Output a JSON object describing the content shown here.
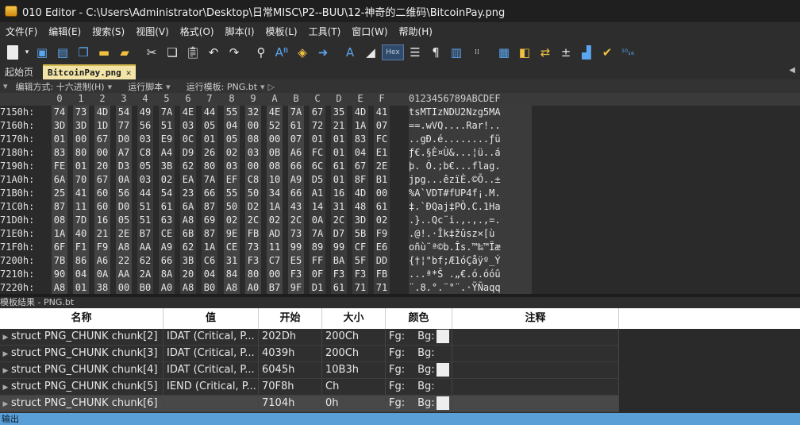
{
  "window": {
    "title": "010 Editor - C:\\Users\\Administrator\\Desktop\\日常MISC\\P2--BUU\\12-神奇的二维码\\BitcoinPay.png"
  },
  "menu": [
    "文件(F)",
    "编辑(E)",
    "搜索(S)",
    "视图(V)",
    "格式(O)",
    "脚本(I)",
    "模板(L)",
    "工具(T)",
    "窗口(W)",
    "帮助(H)"
  ],
  "toolbar": {
    "hex_label": "Hex",
    "icons": [
      "new-file-icon",
      "new-file-dropdown-icon",
      "save-icon",
      "save-as-icon",
      "save-all-icon",
      "open-folder-icon",
      "open-multiple-icon",
      "cut-icon",
      "copy-icon",
      "paste-icon",
      "undo-icon",
      "redo-icon",
      "find-icon",
      "find-replace-icon",
      "find-in-files-icon",
      "goto-icon",
      "font-icon",
      "highlight-icon",
      "hex-mode-icon",
      "word-wrap-icon",
      "show-whitespace-icon",
      "columns-icon",
      "binary-icon",
      "calculator-icon",
      "compare-icon",
      "swap-icon",
      "math-icon",
      "histogram-icon",
      "checksum-icon",
      "base-convert-icon"
    ]
  },
  "tabs": {
    "start_page": "起始页",
    "active_file": "BitcoinPay.png",
    "close": "✕"
  },
  "options": {
    "edit_as": "编辑方式: 十六进制(H)",
    "run_script": "运行脚本",
    "run_template": "运行模板: PNG.bt"
  },
  "hex": {
    "header_cols": [
      "0",
      "1",
      "2",
      "3",
      "4",
      "5",
      "6",
      "7",
      "8",
      "9",
      "A",
      "B",
      "C",
      "D",
      "E",
      "F"
    ],
    "header_ascii": "0123456789ABCDEF",
    "rows": [
      {
        "addr": "7150h:",
        "bytes": [
          "74",
          "73",
          "4D",
          "54",
          "49",
          "7A",
          "4E",
          "44",
          "55",
          "32",
          "4E",
          "7A",
          "67",
          "35",
          "4D",
          "41"
        ],
        "ascii": "tsMTIzNDU2Nzg5MA"
      },
      {
        "addr": "7160h:",
        "bytes": [
          "3D",
          "3D",
          "1D",
          "77",
          "56",
          "51",
          "03",
          "05",
          "04",
          "00",
          "52",
          "61",
          "72",
          "21",
          "1A",
          "07"
        ],
        "ascii": "==.wVQ....Rar!.."
      },
      {
        "addr": "7170h:",
        "bytes": [
          "01",
          "00",
          "67",
          "D0",
          "03",
          "E9",
          "0C",
          "01",
          "05",
          "08",
          "00",
          "07",
          "01",
          "01",
          "83",
          "FC"
        ],
        "ascii": "..gÐ.é........ƒü"
      },
      {
        "addr": "7180h:",
        "bytes": [
          "83",
          "80",
          "00",
          "A7",
          "C8",
          "A4",
          "D9",
          "26",
          "02",
          "03",
          "0B",
          "A6",
          "FC",
          "01",
          "04",
          "E1"
        ],
        "ascii": "ƒ€.§È¤Ù&...¦ü..á"
      },
      {
        "addr": "7190h:",
        "bytes": [
          "FE",
          "01",
          "20",
          "D3",
          "05",
          "3B",
          "62",
          "80",
          "03",
          "00",
          "08",
          "66",
          "6C",
          "61",
          "67",
          "2E"
        ],
        "ascii": "þ. Ó.;b€...flag."
      },
      {
        "addr": "71A0h:",
        "bytes": [
          "6A",
          "70",
          "67",
          "0A",
          "03",
          "02",
          "EA",
          "7A",
          "EF",
          "C8",
          "10",
          "A9",
          "D5",
          "01",
          "8F",
          "B1"
        ],
        "ascii": "jpg...êzïÈ.©Õ..±"
      },
      {
        "addr": "71B0h:",
        "bytes": [
          "25",
          "41",
          "60",
          "56",
          "44",
          "54",
          "23",
          "66",
          "55",
          "50",
          "34",
          "66",
          "A1",
          "16",
          "4D",
          "00"
        ],
        "ascii": "%A`VDT#fUP4f¡.M."
      },
      {
        "addr": "71C0h:",
        "bytes": [
          "87",
          "11",
          "60",
          "D0",
          "51",
          "61",
          "6A",
          "87",
          "50",
          "D2",
          "1A",
          "43",
          "14",
          "31",
          "48",
          "61"
        ],
        "ascii": "‡.`ÐQaj‡PÒ.C.1Ha"
      },
      {
        "addr": "71D0h:",
        "bytes": [
          "08",
          "7D",
          "16",
          "05",
          "51",
          "63",
          "A8",
          "69",
          "02",
          "2C",
          "02",
          "2C",
          "0A",
          "2C",
          "3D",
          "02"
        ],
        "ascii": ".}..Qc¨i.,.,.,=."
      },
      {
        "addr": "71E0h:",
        "bytes": [
          "1A",
          "40",
          "21",
          "2E",
          "B7",
          "CE",
          "6B",
          "87",
          "9E",
          "FB",
          "AD",
          "73",
          "7A",
          "D7",
          "5B",
          "F9"
        ],
        "ascii": ".@!.·Îk‡žû­sz×[ù"
      },
      {
        "addr": "71F0h:",
        "bytes": [
          "6F",
          "F1",
          "F9",
          "A8",
          "AA",
          "A9",
          "62",
          "1A",
          "CE",
          "73",
          "11",
          "99",
          "89",
          "99",
          "CF",
          "E6"
        ],
        "ascii": "oñù¨ª©b.Îs.™‰™Ïæ"
      },
      {
        "addr": "7200h:",
        "bytes": [
          "7B",
          "86",
          "A6",
          "22",
          "62",
          "66",
          "3B",
          "C6",
          "31",
          "F3",
          "C7",
          "E5",
          "FF",
          "BA",
          "5F",
          "DD"
        ],
        "ascii": "{†¦\"bf;Æ1óÇåÿº_Ý"
      },
      {
        "addr": "7210h:",
        "bytes": [
          "90",
          "04",
          "0A",
          "AA",
          "2A",
          "8A",
          "20",
          "04",
          "84",
          "80",
          "00",
          "F3",
          "0F",
          "F3",
          "F3",
          "FB"
        ],
        "ascii": "...ª*Š .„€.ó.óóû"
      },
      {
        "addr": "7220h:",
        "bytes": [
          "A8",
          "01",
          "38",
          "00",
          "B0",
          "A0",
          "A8",
          "B0",
          "A8",
          "A0",
          "B7",
          "9F",
          "D1",
          "61",
          "71",
          "71"
        ],
        "ascii": "¨.8.°.¨°¨.·ŸÑaqq"
      }
    ]
  },
  "template_results": {
    "title": "模板结果 - PNG.bt",
    "columns": [
      "名称",
      "值",
      "开始",
      "大小",
      "颜色",
      "注释"
    ],
    "rows": [
      {
        "name": "struct PNG_CHUNK chunk[2]",
        "value": "IDAT  (Critical, P...",
        "start": "202Dh",
        "size": "200Ch",
        "fg": "Fg:",
        "bg": "Bg:",
        "bg_swatch": true
      },
      {
        "name": "struct PNG_CHUNK chunk[3]",
        "value": "IDAT  (Critical, P...",
        "start": "4039h",
        "size": "200Ch",
        "fg": "Fg:",
        "bg": "Bg:",
        "bg_swatch": false
      },
      {
        "name": "struct PNG_CHUNK chunk[4]",
        "value": "IDAT  (Critical, P...",
        "start": "6045h",
        "size": "10B3h",
        "fg": "Fg:",
        "bg": "Bg:",
        "bg_swatch": true
      },
      {
        "name": "struct PNG_CHUNK chunk[5]",
        "value": "IEND  (Critical, P...",
        "start": "70F8h",
        "size": "Ch",
        "fg": "Fg:",
        "bg": "Bg:",
        "bg_swatch": false
      },
      {
        "name": "struct PNG_CHUNK chunk[6]",
        "value": "",
        "start": "7104h",
        "size": "0h",
        "fg": "Fg:",
        "bg": "Bg:",
        "bg_swatch": true
      }
    ]
  },
  "status": {
    "output_label": "输出"
  }
}
